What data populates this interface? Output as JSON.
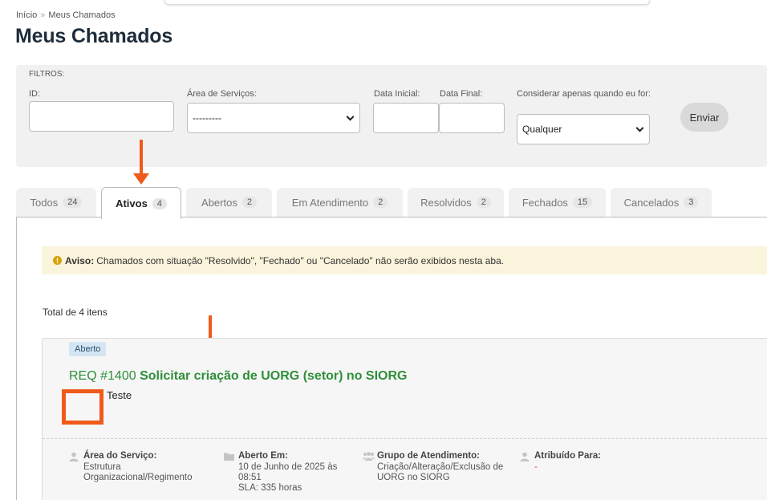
{
  "breadcrumb": {
    "home": "Início",
    "separator": "»",
    "current": "Meus Chamados"
  },
  "page": {
    "title": "Meus Chamados"
  },
  "filters": {
    "title": "FILTROS:",
    "id_label": "ID:",
    "id_value": "",
    "area_label": "Área de Serviços:",
    "area_value": "---------",
    "start_date_label": "Data Inicial:",
    "end_date_label": "Data Final:",
    "consider_label": "Considerar apenas quando eu for:",
    "consider_value": "Qualquer",
    "submit_label": "Enviar"
  },
  "tabs": [
    {
      "label": "Todos",
      "count": "24"
    },
    {
      "label": "Ativos",
      "count": "4"
    },
    {
      "label": "Abertos",
      "count": "2"
    },
    {
      "label": "Em Atendimento",
      "count": "2"
    },
    {
      "label": "Resolvidos",
      "count": "2"
    },
    {
      "label": "Fechados",
      "count": "15"
    },
    {
      "label": "Cancelados",
      "count": "3"
    }
  ],
  "notice": {
    "bold": "Aviso:",
    "text": "Chamados com situação \"Resolvido\", \"Fechado\" ou \"Cancelado\" não serão exibidos nesta aba."
  },
  "total_text": "Total de 4 itens",
  "ticket": {
    "status": "Aberto",
    "number": "REQ #1400",
    "title": "Solicitar criação de UORG (setor) no SIORG",
    "description": "Teste",
    "area_label": "Área do Serviço:",
    "area_value": "Estrutura Organizacional/Regimento",
    "opened_label": "Aberto Em:",
    "opened_value": "10 de Junho de 2025 às 08:51",
    "sla": "SLA: 335 horas",
    "group_label": "Grupo de Atendimento:",
    "group_value": "Criação/Alteração/Exclusão de UORG no SIORG",
    "assigned_label": "Atribuído Para:",
    "assigned_value": "-"
  },
  "colors": {
    "accent_green": "#2f8f3a",
    "annotation_orange": "#f05a1a",
    "notice_bg": "#fbf4dc"
  }
}
